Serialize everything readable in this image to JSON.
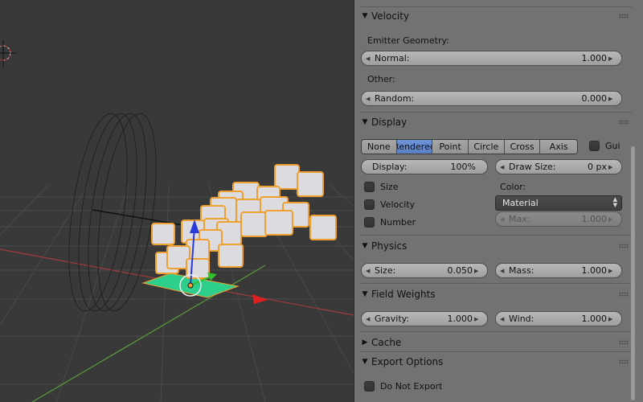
{
  "viewport": {
    "colors": {
      "background": "#393939",
      "grid": "#4a4a4a",
      "x_axis": "#a33a3a",
      "y_axis": "#5b9a3a",
      "selection": "#f0a030",
      "emitter": "#2ecf8a"
    }
  },
  "panels": {
    "velocity": {
      "title": "Velocity",
      "emitter_geometry_label": "Emitter Geometry:",
      "normal": {
        "label": "Normal:",
        "value": "1.000"
      },
      "other_label": "Other:",
      "random": {
        "label": "Random:",
        "value": "0.000"
      }
    },
    "display": {
      "title": "Display",
      "modes": [
        "None",
        "Rendered",
        "Point",
        "Circle",
        "Cross",
        "Axis"
      ],
      "active_mode": "Rendered",
      "gui_label": "Gui",
      "display_field": {
        "label": "Display:",
        "value": "100%"
      },
      "draw_size": {
        "label": "Draw Size:",
        "value": "0 px"
      },
      "size_label": "Size",
      "velocity_label": "Velocity",
      "number_label": "Number",
      "color_label": "Color:",
      "color_select": "Material",
      "max": {
        "label": "Max:",
        "value": "1.000"
      }
    },
    "physics": {
      "title": "Physics",
      "size": {
        "label": "Size:",
        "value": "0.050"
      },
      "mass": {
        "label": "Mass:",
        "value": "1.000"
      }
    },
    "field_weights": {
      "title": "Field Weights",
      "gravity": {
        "label": "Gravity:",
        "value": "1.000"
      },
      "wind": {
        "label": "Wind:",
        "value": "1.000"
      }
    },
    "cache": {
      "title": "Cache"
    },
    "export_options": {
      "title": "Export Options",
      "do_not_export_label": "Do Not Export"
    }
  },
  "icons": [
    "collapse-triangle-icon",
    "expand-triangle-icon",
    "grip-icon",
    "decrement-arrow-icon",
    "increment-arrow-icon",
    "select-arrows-icon",
    "3d-cursor-icon",
    "manipulator-icon"
  ]
}
